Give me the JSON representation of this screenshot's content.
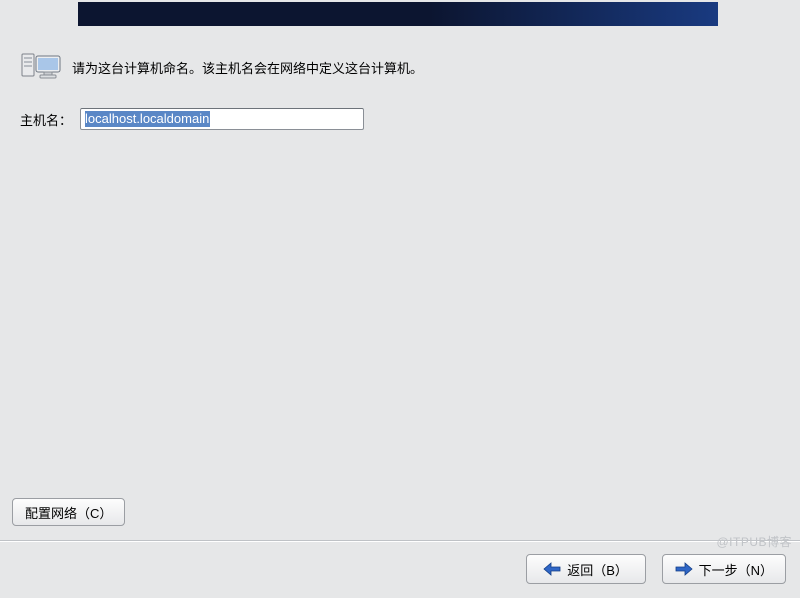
{
  "header": {
    "instruction": "请为这台计算机命名。该主机名会在网络中定义这台计算机。"
  },
  "form": {
    "hostname_label": "主机名：",
    "hostname_value": "localhost.localdomain"
  },
  "buttons": {
    "configure_network": "配置网络（C）",
    "back": "返回（B）",
    "next": "下一步（N）"
  },
  "watermark": "@ITPUB博客",
  "icons": {
    "header_icon": "computers-icon",
    "back_icon": "arrow-left-icon",
    "next_icon": "arrow-right-icon"
  }
}
